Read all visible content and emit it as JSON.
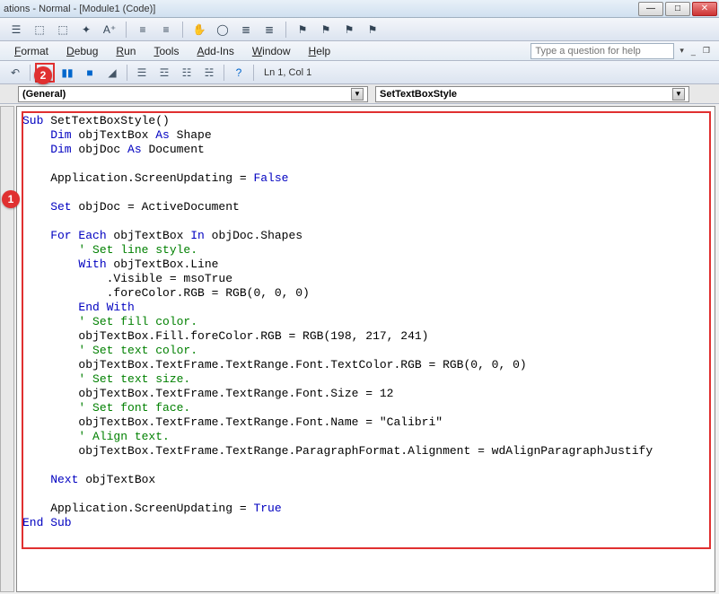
{
  "window": {
    "title": "ations - Normal - [Module1 (Code)]"
  },
  "menu": {
    "format": "Format",
    "debug": "Debug",
    "run": "Run",
    "tools": "Tools",
    "addins": "Add-Ins",
    "window": "Window",
    "help": "Help"
  },
  "helpbox": {
    "placeholder": "Type a question for help"
  },
  "status": {
    "pos": "Ln 1, Col 1"
  },
  "dropdowns": {
    "left": "(General)",
    "right": "SetTextBoxStyle"
  },
  "callouts": {
    "c1": "1",
    "c2": "2"
  },
  "code": {
    "l1a": "Sub",
    "l1b": " SetTextBoxStyle()",
    "l2a": "    Dim",
    "l2b": " objTextBox ",
    "l2c": "As",
    "l2d": " Shape",
    "l3a": "    Dim",
    "l3b": " objDoc ",
    "l3c": "As",
    "l3d": " Document",
    "l5": "    Application.ScreenUpdating = ",
    "l5b": "False",
    "l7a": "    Set",
    "l7b": " objDoc = ActiveDocument",
    "l9a": "    For Each",
    "l9b": " objTextBox ",
    "l9c": "In",
    "l9d": " objDoc.Shapes",
    "l10": "        ' Set line style.",
    "l11a": "        With",
    "l11b": " objTextBox.Line",
    "l12": "            .Visible = msoTrue",
    "l13": "            .foreColor.RGB = RGB(0, 0, 0)",
    "l14": "        End With",
    "l15": "        ' Set fill color.",
    "l16": "        objTextBox.Fill.foreColor.RGB = RGB(198, 217, 241)",
    "l17": "        ' Set text color.",
    "l18": "        objTextBox.TextFrame.TextRange.Font.TextColor.RGB = RGB(0, 0, 0)",
    "l19": "        ' Set text size.",
    "l20": "        objTextBox.TextFrame.TextRange.Font.Size = 12",
    "l21": "        ' Set font face.",
    "l22": "        objTextBox.TextFrame.TextRange.Font.Name = \"Calibri\"",
    "l23": "        ' Align text.",
    "l24": "        objTextBox.TextFrame.TextRange.ParagraphFormat.Alignment = wdAlignParagraphJustify",
    "l26a": "    Next",
    "l26b": " objTextBox",
    "l28": "    Application.ScreenUpdating = ",
    "l28b": "True",
    "l29": "End Sub"
  }
}
